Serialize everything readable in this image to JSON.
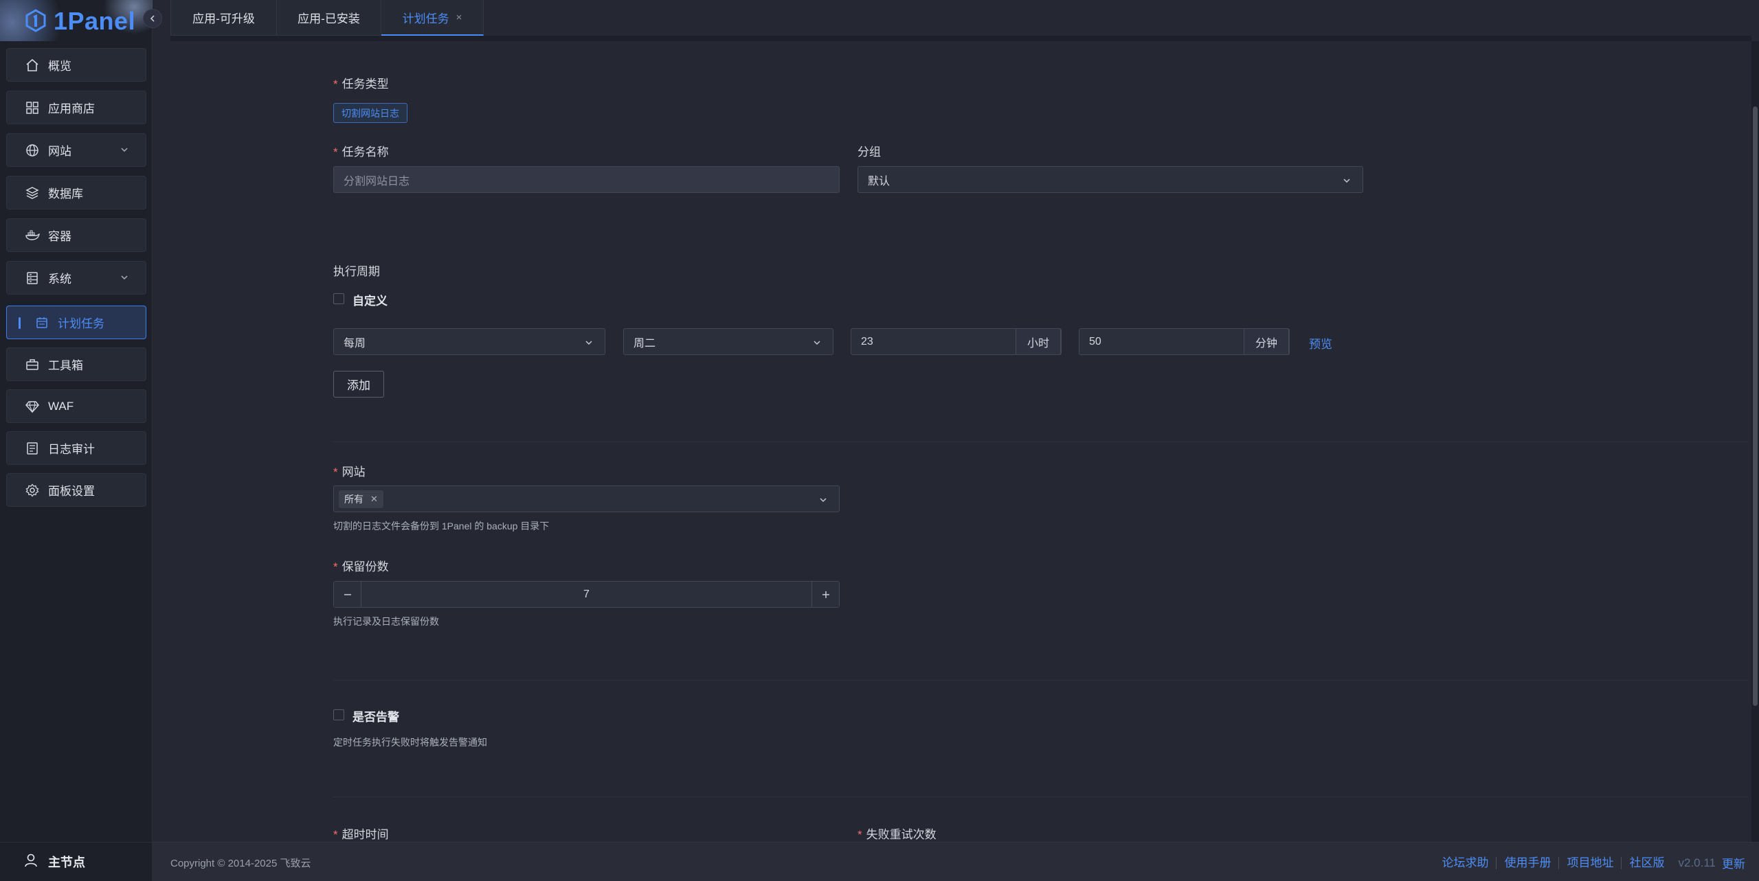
{
  "app": {
    "logo_text": "1Panel"
  },
  "sidebar": {
    "items": [
      {
        "label": "概览",
        "icon": "home-icon"
      },
      {
        "label": "应用商店",
        "icon": "apps-icon"
      },
      {
        "label": "网站",
        "icon": "globe-icon",
        "expandable": true
      },
      {
        "label": "数据库",
        "icon": "database-icon"
      },
      {
        "label": "容器",
        "icon": "docker-icon"
      },
      {
        "label": "系统",
        "icon": "server-icon",
        "expandable": true
      },
      {
        "label": "计划任务",
        "icon": "calendar-icon",
        "active": true
      },
      {
        "label": "工具箱",
        "icon": "toolbox-icon"
      },
      {
        "label": "WAF",
        "icon": "diamond-icon"
      },
      {
        "label": "日志审计",
        "icon": "log-icon"
      },
      {
        "label": "面板设置",
        "icon": "gear-icon"
      }
    ],
    "footer_label": "主节点"
  },
  "tabs": [
    {
      "label": "应用-可升级"
    },
    {
      "label": "应用-已安装"
    },
    {
      "label": "计划任务",
      "active": true,
      "close": "×"
    }
  ],
  "form": {
    "task_type": {
      "label": "任务类型",
      "value": "切割网站日志"
    },
    "task_name": {
      "label": "任务名称",
      "placeholder": "分割网站日志"
    },
    "group": {
      "label": "分组",
      "value": "默认"
    },
    "cycle": {
      "label": "执行周期",
      "custom_label": "自定义",
      "period": "每周",
      "weekday": "周二",
      "hour": "23",
      "hour_unit": "小时",
      "minute": "50",
      "minute_unit": "分钟",
      "preview": "预览",
      "add_button": "添加"
    },
    "website": {
      "label": "网站",
      "chip": "所有",
      "hint": "切割的日志文件会备份到 1Panel 的 backup 目录下"
    },
    "retain": {
      "label": "保留份数",
      "value": "7",
      "hint": "执行记录及日志保留份数"
    },
    "alert": {
      "label": "是否告警",
      "hint": "定时任务执行失败时将触发告警通知"
    },
    "timeout": {
      "label": "超时时间"
    },
    "retry": {
      "label": "失败重试次数"
    }
  },
  "footer": {
    "copyright": "Copyright © 2014-2025 飞致云",
    "links": [
      "论坛求助",
      "使用手册",
      "项目地址",
      "社区版"
    ],
    "version": "v2.0.11",
    "update": "更新"
  },
  "colors": {
    "accent": "#4d8df7",
    "required": "#f56c6c",
    "background": "#252833",
    "sidebar": "#1d2029"
  }
}
